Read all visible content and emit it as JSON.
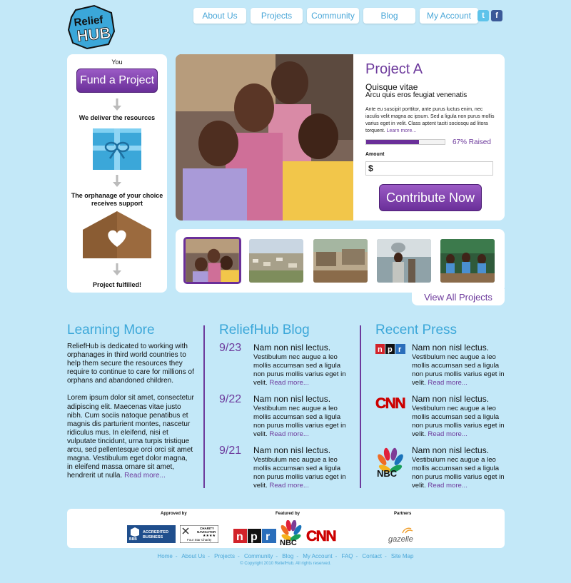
{
  "logo": {
    "line1": "Relief",
    "line2": "HUB"
  },
  "nav": [
    "About Us",
    "Projects",
    "Community",
    "Blog",
    "My Account"
  ],
  "steps": {
    "you": "You",
    "fund_button": "Fund a Project",
    "deliver": "We deliver the resources",
    "orphanage_line1": "The orphanage of your choice",
    "orphanage_line2": "receives support",
    "fulfilled": "Project fulfilled!"
  },
  "project": {
    "title": "Project A",
    "subtitle": "Quisque vitae",
    "tagline": "Arcu quis eros feugiat venenatis",
    "description": "Ante eu suscipit porttitor, ante purus luctus enim, nec iaculis velit magna ac ipsum. Sed a ligula non purus mollis varius eget in velit. Class aptent taciti sociosqu ad litora torquent.",
    "learn_more": "Learn more...",
    "raised_fraction": 0.67,
    "raised_label": "67% Raised",
    "amount_label": "Amount",
    "amount_prefix": "$",
    "contribute_button": "Contribute Now"
  },
  "view_all": "View All Projects",
  "learning": {
    "heading": "Learning More",
    "para1": "ReliefHub is dedicated to working with orphanages in third world countries to help them secure the resources they require to continue to care for millions of orphans and abandoned children.",
    "para2": "Lorem ipsum dolor sit amet, consectetur adipiscing elit. Maecenas vitae justo nibh. Cum sociis natoque penatibus et magnis dis parturient montes, nascetur ridiculus mus. In eleifend, nisi et vulputate tincidunt, urna turpis tristique arcu, sed pellentesque orci orci sit amet magna. Vestibulum eget dolor magna, in eleifend massa ornare sit amet, hendrerit ut nulla.",
    "read_more": "Read more..."
  },
  "blog": {
    "heading": "ReliefHub Blog",
    "entries": [
      {
        "date": "9/23",
        "title": "Nam non nisl lectus.",
        "text": "Vestibulum nec augue a leo mollis accumsan sed a ligula non purus mollis varius eget in velit.",
        "read_more": "Read more..."
      },
      {
        "date": "9/22",
        "title": "Nam non nisl lectus.",
        "text": "Vestibulum nec augue a leo mollis accumsan sed a ligula non purus mollis varius eget in velit.",
        "read_more": "Read more..."
      },
      {
        "date": "9/21",
        "title": "Nam non nisl lectus.",
        "text": "Vestibulum nec augue a leo mollis accumsan sed a ligula non purus mollis varius eget in velit.",
        "read_more": "Read more..."
      }
    ]
  },
  "press": {
    "heading": "Recent Press",
    "entries": [
      {
        "source": "npr",
        "title": "Nam non nisl lectus.",
        "text": "Vestibulum nec augue a leo mollis accumsan sed a ligula non purus mollis varius eget in velit.",
        "read_more": "Read more..."
      },
      {
        "source": "CNN",
        "title": "Nam non nisl lectus.",
        "text": "Vestibulum nec augue a leo mollis accumsan sed a ligula non purus mollis varius eget in velit.",
        "read_more": "Read more..."
      },
      {
        "source": "NBC",
        "title": "Nam non nisl lectus.",
        "text": "Vestibulum nec augue a leo mollis accumsan sed a ligula non purus mollis varius eget in velit.",
        "read_more": "Read more..."
      }
    ]
  },
  "strip": {
    "approved_label": "Approved by",
    "featured_label": "Featured by",
    "partners_label": "Partners",
    "bbb_line1": "ACCREDITED",
    "bbb_line2": "BUSINESS",
    "bbb_mark": "BBB",
    "charity_line1": "CHARITY",
    "charity_line2": "NAVIGATOR",
    "charity_line3": "Four Star Charity",
    "featured_npr": "npr",
    "featured_nbc": "NBC",
    "featured_cnn": "CNN",
    "partner_name": "gazelle"
  },
  "footer": {
    "links": [
      "Home",
      "About Us",
      "Projects",
      "Community",
      "Blog",
      "My Account",
      "FAQ",
      "Contact",
      "Site Map"
    ],
    "copyright": "© Copyright 2010 ReliefHub. All rights reserved."
  },
  "colors": {
    "background": "#c3e8f8",
    "accent_purple": "#6a2f99",
    "accent_blue": "#3ba7d9"
  }
}
